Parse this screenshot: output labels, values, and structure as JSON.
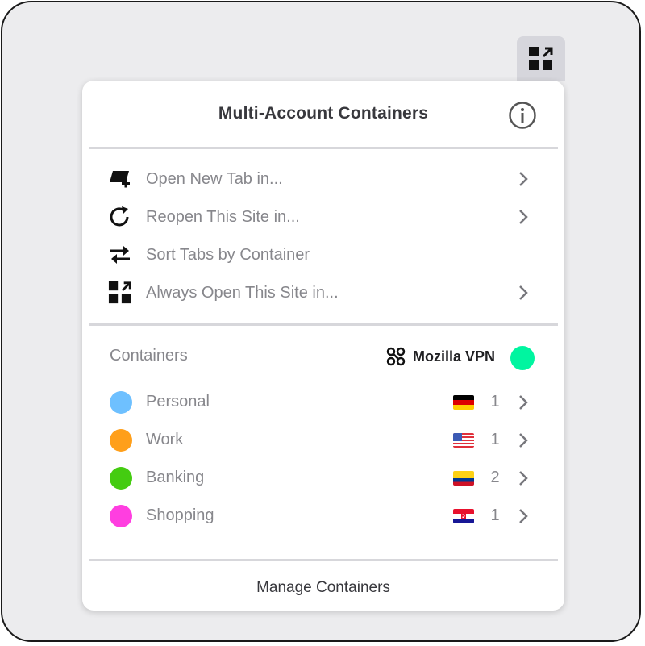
{
  "toolbar": {
    "icon": "containers-toolbar-icon"
  },
  "panel": {
    "title": "Multi-Account Containers",
    "info_icon": "info-icon"
  },
  "menu": [
    {
      "label": "Open New Tab in...",
      "icon": "new-tab-icon",
      "has_chevron": true
    },
    {
      "label": "Reopen This Site in...",
      "icon": "reopen-icon",
      "has_chevron": true
    },
    {
      "label": "Sort Tabs by Container",
      "icon": "sort-icon",
      "has_chevron": false
    },
    {
      "label": "Always Open This Site in...",
      "icon": "always-open-icon",
      "has_chevron": true
    }
  ],
  "containers_section": {
    "label": "Containers",
    "vpn_label": "Mozilla VPN",
    "vpn_color": "#00f5a0"
  },
  "containers": [
    {
      "name": "Personal",
      "color": "#6ec0ff",
      "flag": "Germany",
      "count": "1"
    },
    {
      "name": "Work",
      "color": "#ff9f1a",
      "flag": "United States",
      "count": "1"
    },
    {
      "name": "Banking",
      "color": "#44cc11",
      "flag": "Colombia",
      "count": "2"
    },
    {
      "name": "Shopping",
      "color": "#ff3ee0",
      "flag": "Croatia",
      "count": "1"
    }
  ],
  "footer": {
    "manage_label": "Manage Containers"
  },
  "colors": {
    "text_muted": "#87878c",
    "text_dark": "#38383d",
    "divider": "#d7d7db"
  }
}
